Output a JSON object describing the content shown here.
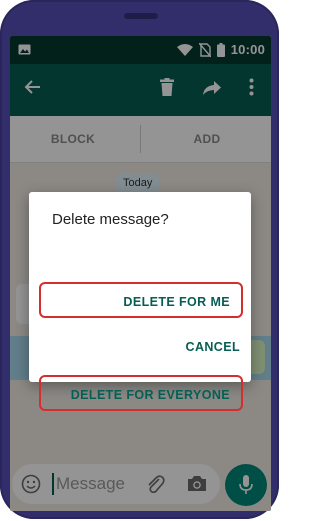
{
  "status_bar": {
    "time": "10:00",
    "icons": [
      "image-notification-icon",
      "wifi-icon",
      "no-sim-icon",
      "battery-icon"
    ]
  },
  "toolbar": {
    "icons": [
      "back-arrow-icon",
      "delete-icon",
      "forward-icon",
      "more-vert-icon"
    ]
  },
  "action_bar": {
    "block_label": "BLOCK",
    "add_label": "ADD"
  },
  "chat": {
    "date_label": "Today"
  },
  "composer": {
    "placeholder": "Message",
    "icons": [
      "emoji-icon",
      "attach-icon",
      "camera-icon",
      "mic-icon"
    ]
  },
  "dialog": {
    "title": "Delete message?",
    "delete_for_me": "DELETE FOR ME",
    "cancel": "CANCEL",
    "delete_for_everyone": "DELETE FOR EVERYONE"
  },
  "colors": {
    "status_bar": "#053a2f",
    "toolbar": "#075e54",
    "accent": "#00897b",
    "highlight_border": "#d62d2d",
    "phone_frame": "#322e6b"
  }
}
